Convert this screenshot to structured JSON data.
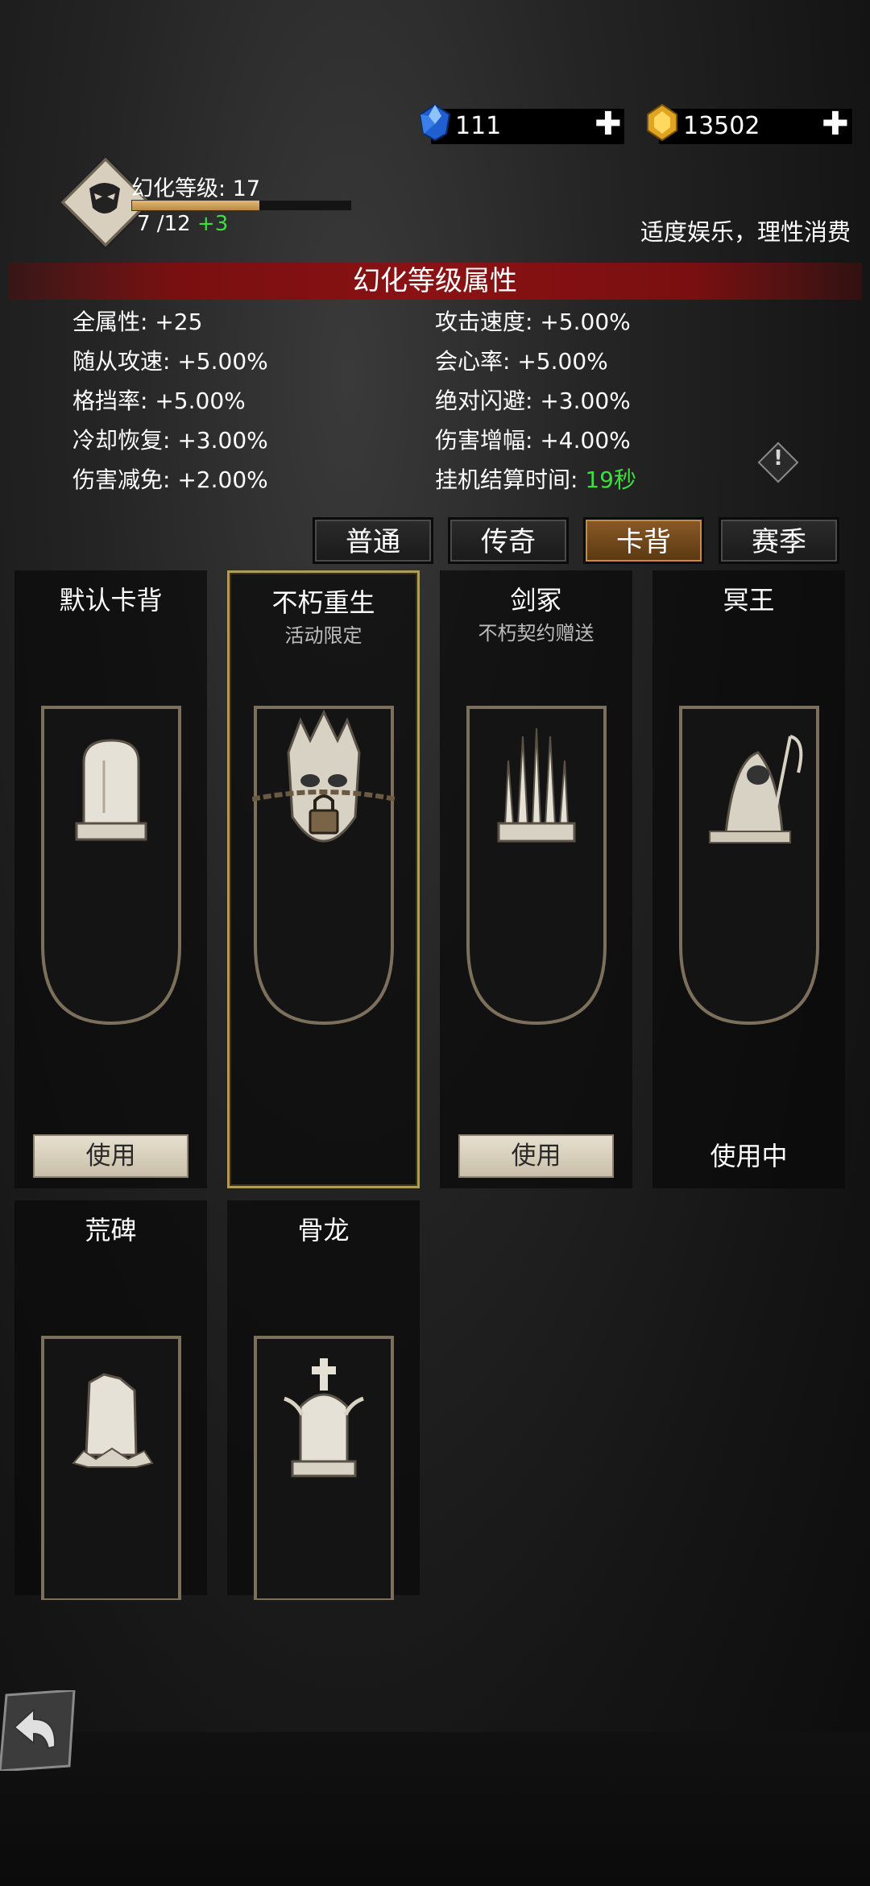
{
  "currencies": [
    {
      "name": "diamond",
      "value": "111",
      "icon": "blue-gem-icon",
      "color": "#2d6fe0"
    },
    {
      "name": "gold",
      "value": "13502",
      "icon": "gold-gem-icon",
      "color": "#e8b630"
    }
  ],
  "level": {
    "label": "幻化等级: 17",
    "progress_text": "7 /12",
    "gain_text": "+3",
    "progress_fraction": 0.58
  },
  "slogan": "适度娱乐，理性消费",
  "section_title": "幻化等级属性",
  "attributes": [
    {
      "text": "全属性: +25"
    },
    {
      "text": "攻击速度: +5.00%"
    },
    {
      "text": "随从攻速: +5.00%"
    },
    {
      "text": "会心率: +5.00%"
    },
    {
      "text": "格挡率: +5.00%"
    },
    {
      "text": "绝对闪避: +3.00%"
    },
    {
      "text": "冷却恢复: +3.00%"
    },
    {
      "text": "伤害增幅: +4.00%"
    },
    {
      "text": "伤害减免: +2.00%"
    },
    {
      "label": "挂机结算时间: ",
      "value": "19秒"
    }
  ],
  "tabs": [
    {
      "label": "普通",
      "active": false
    },
    {
      "label": "传奇",
      "active": false
    },
    {
      "label": "卡背",
      "active": true
    },
    {
      "label": "赛季",
      "active": false
    }
  ],
  "cards": [
    {
      "title": "默认卡背",
      "subtitle": "",
      "button": "使用",
      "art": "tombstone-icon"
    },
    {
      "title": "不朽重生",
      "subtitle": "活动限定",
      "button": "",
      "art": "locked-skull-icon",
      "selected": true,
      "locked": true
    },
    {
      "title": "剑冢",
      "subtitle": "不朽契约赠送",
      "button": "使用",
      "art": "sword-throne-icon"
    },
    {
      "title": "冥王",
      "subtitle": "",
      "status": "使用中",
      "art": "reaper-icon"
    },
    {
      "title": "荒碑",
      "subtitle": "",
      "art": "ruined-stone-icon"
    },
    {
      "title": "骨龙",
      "subtitle": "",
      "art": "bone-dragon-tomb-icon"
    }
  ],
  "colors": {
    "accent_red": "#8a1214",
    "gain_green": "#3ce03c",
    "selected_gold": "#b29a5c"
  }
}
